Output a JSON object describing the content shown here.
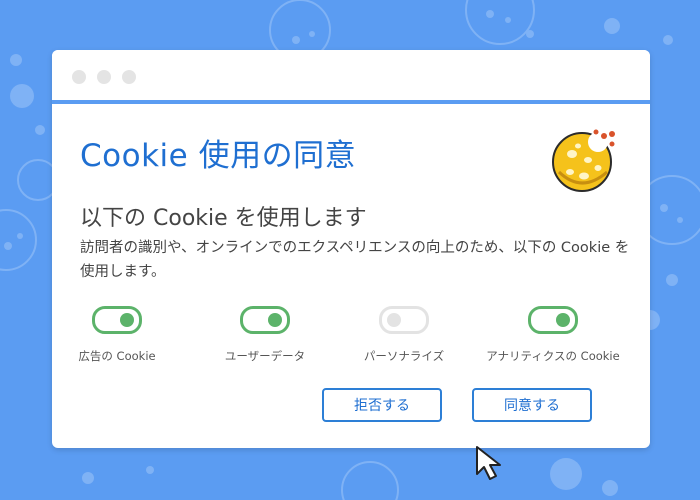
{
  "dialog": {
    "title": "Cookie 使用の同意",
    "subtitle": "以下の Cookie を使用します",
    "description": "訪問者の識別や、オンラインでのエクスペリエンスの向上のため、以下の Cookie を使用します。"
  },
  "toggles": [
    {
      "label": "広告の Cookie",
      "state": "on"
    },
    {
      "label": "ユーザーデータ",
      "state": "on"
    },
    {
      "label": "パーソナライズ",
      "state": "off"
    },
    {
      "label": "アナリティクスの Cookie",
      "state": "on"
    }
  ],
  "buttons": {
    "reject_label": "拒否する",
    "accept_label": "同意する"
  },
  "colors": {
    "background": "#5b9cf2",
    "accent": "#1f6fd1",
    "toggle_on": "#5cb36a",
    "toggle_off": "#e3e3e3"
  },
  "icons": [
    "cookie-icon",
    "mouse-cursor-icon"
  ]
}
